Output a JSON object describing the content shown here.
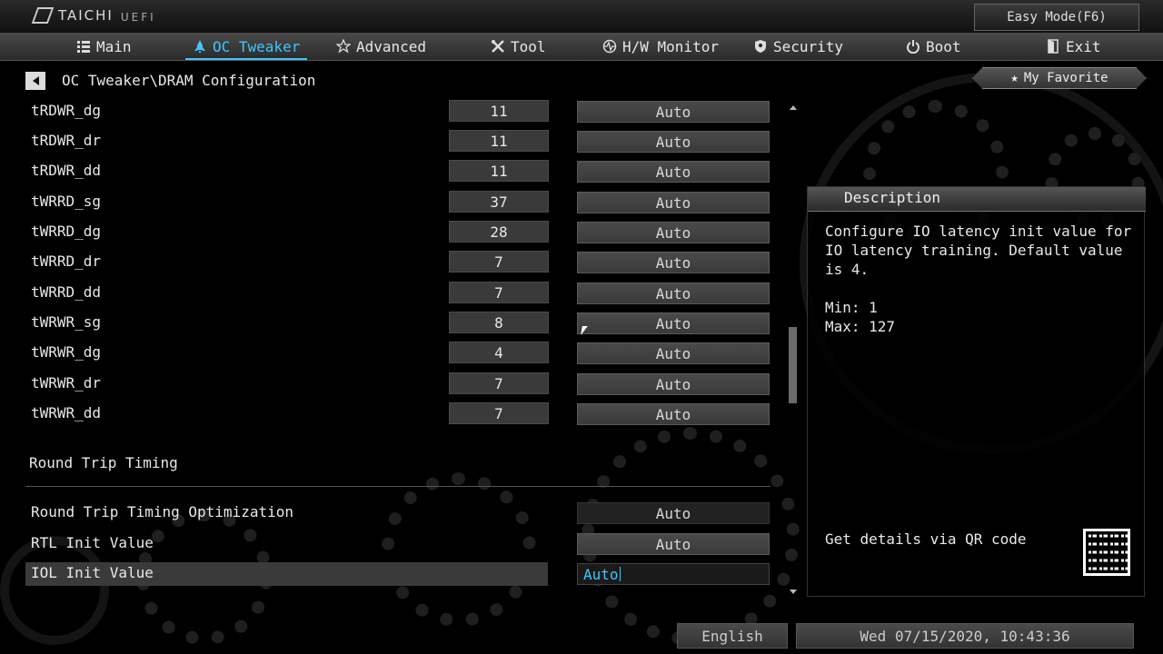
{
  "brand": {
    "name": "TAICHI",
    "sub": "UEFI"
  },
  "easy_mode_label": "Easy Mode(F6)",
  "nav": [
    {
      "label": "Main",
      "icon": "list-icon"
    },
    {
      "label": "OC Tweaker",
      "icon": "rocket-icon",
      "active": true
    },
    {
      "label": "Advanced",
      "icon": "star-icon"
    },
    {
      "label": "Tool",
      "icon": "tools-icon"
    },
    {
      "label": "H/W Monitor",
      "icon": "monitor-icon"
    },
    {
      "label": "Security",
      "icon": "shield-icon"
    },
    {
      "label": "Boot",
      "icon": "power-icon"
    },
    {
      "label": "Exit",
      "icon": "exit-icon"
    }
  ],
  "breadcrumb": "OC Tweaker\\DRAM Configuration",
  "favorite_label": "My Favorite",
  "timings": [
    {
      "label": "tRDWR_dg",
      "value": "11",
      "option": "Auto"
    },
    {
      "label": "tRDWR_dr",
      "value": "11",
      "option": "Auto"
    },
    {
      "label": "tRDWR_dd",
      "value": "11",
      "option": "Auto"
    },
    {
      "label": "tWRRD_sg",
      "value": "37",
      "option": "Auto"
    },
    {
      "label": "tWRRD_dg",
      "value": "28",
      "option": "Auto"
    },
    {
      "label": "tWRRD_dr",
      "value": "7",
      "option": "Auto"
    },
    {
      "label": "tWRRD_dd",
      "value": "7",
      "option": "Auto"
    },
    {
      "label": "tWRWR_sg",
      "value": "8",
      "option": "Auto"
    },
    {
      "label": "tWRWR_dg",
      "value": "4",
      "option": "Auto"
    },
    {
      "label": "tWRWR_dr",
      "value": "7",
      "option": "Auto"
    },
    {
      "label": "tWRWR_dd",
      "value": "7",
      "option": "Auto"
    }
  ],
  "section_title": "Round Trip Timing",
  "rtt": [
    {
      "label": "Round Trip Timing Optimization",
      "option": "Auto"
    },
    {
      "label": "RTL Init Value",
      "option": "Auto"
    },
    {
      "label": "IOL Init Value",
      "option": "Auto",
      "selected": true
    }
  ],
  "description": {
    "title": "Description",
    "text": "Configure IO latency init value for IO latency training. Default value is 4.\n\nMin: 1\nMax: 127",
    "qr_label": "Get details via QR code"
  },
  "footer": {
    "language": "English",
    "datetime": "Wed 07/15/2020, 10:43:36"
  }
}
